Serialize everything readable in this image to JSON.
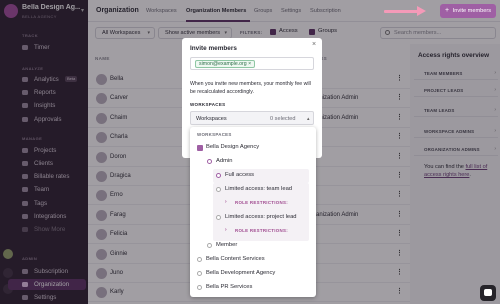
{
  "workspace": {
    "name": "Bella Design Ag...",
    "subtitle": "BELLA AGENCY"
  },
  "sidebar": {
    "sections": {
      "track": "TRACK",
      "analyze": "ANALYZE",
      "manage": "MANAGE",
      "admin": "ADMIN"
    },
    "items": [
      {
        "label": "Timer"
      },
      {
        "label": "Analytics",
        "badge": "Beta"
      },
      {
        "label": "Reports"
      },
      {
        "label": "Insights"
      },
      {
        "label": "Approvals"
      },
      {
        "label": "Projects"
      },
      {
        "label": "Clients"
      },
      {
        "label": "Billable rates"
      },
      {
        "label": "Team"
      },
      {
        "label": "Tags"
      },
      {
        "label": "Integrations"
      },
      {
        "label": "Show More"
      },
      {
        "label": "Subscription"
      },
      {
        "label": "Organization"
      },
      {
        "label": "Settings"
      }
    ]
  },
  "header": {
    "title": "Organization",
    "tabs": [
      {
        "label": "Workspaces"
      },
      {
        "label": "Organization Members"
      },
      {
        "label": "Groups"
      },
      {
        "label": "Settings"
      },
      {
        "label": "Subscription"
      }
    ],
    "active_tab": "Organization Members",
    "invite_label": "Invite members",
    "invite_icon": "plus"
  },
  "filters": {
    "workspaces": "All Workspaces",
    "members": "Show active members",
    "label": "FILTERS:",
    "access": "Access",
    "groups": "Groups",
    "search_placeholder": "Search members..."
  },
  "table": {
    "headers": {
      "name": "NAME",
      "access": "ACCESS"
    },
    "rows": [
      {
        "name": "Bella",
        "access": ""
      },
      {
        "name": "Carver",
        "access": "Organization Admin"
      },
      {
        "name": "Chaim",
        "access": "Organization Admin"
      },
      {
        "name": "Charla",
        "access": ""
      },
      {
        "name": "Doron",
        "access": ""
      },
      {
        "name": "Dragica",
        "access": ""
      },
      {
        "name": "Erno",
        "access": ""
      },
      {
        "name": "Farag",
        "access": "Organization Admin"
      },
      {
        "name": "Felicia",
        "access": ""
      },
      {
        "name": "Ginnie",
        "access": ""
      },
      {
        "name": "Juno",
        "access": ""
      },
      {
        "name": "Karly",
        "access": ""
      }
    ]
  },
  "rights_panel": {
    "title": "Access rights overview",
    "sections": [
      {
        "label": "TEAM MEMBERS"
      },
      {
        "label": "PROJECT LEADS"
      },
      {
        "label": "TEAM LEADS"
      },
      {
        "label": "WORKSPACE ADMINS"
      },
      {
        "label": "ORGANIZATION ADMINS"
      }
    ],
    "text_before": "You can find the ",
    "link": "full list of access rights here",
    "text_after": "."
  },
  "modal": {
    "title": "Invite members",
    "close": "×",
    "email_chip": "simon@example.org",
    "chip_remove": "×",
    "note": "When you invite new members, your monthly fee will be recalculated accordingly.",
    "workspaces_label": "WORKSPACES",
    "select_label": "Workspaces",
    "select_value": "0 selected"
  },
  "dropdown": {
    "label": "WORKSPACES",
    "workspace_1": "Bella Design Agency",
    "admin": "Admin",
    "full_access": "Full access",
    "limited_team_lead": "Limited access: team lead",
    "role_restrictions": "ROLE RESTRICTIONS:",
    "limited_project_lead": "Limited access: project lead",
    "member": "Member",
    "workspace_2": "Bella Content Services",
    "workspace_3": "Bella Development Agency",
    "workspace_4": "Bella PR Services"
  },
  "colors": {
    "sidebar_bg": "#2a1e2e",
    "accent": "#9f5fa4",
    "annotation_arrow": "#f49ab8"
  }
}
